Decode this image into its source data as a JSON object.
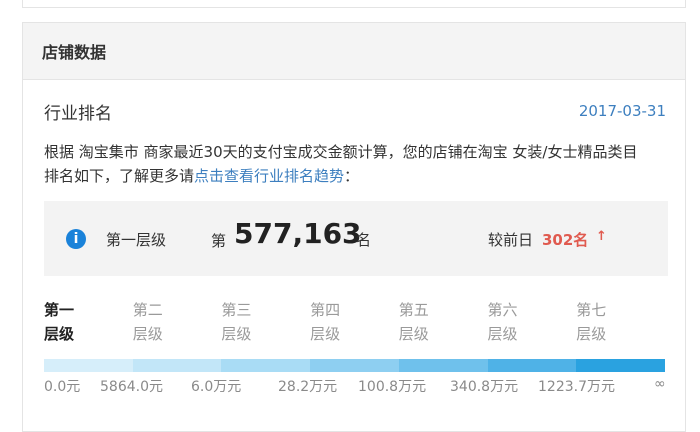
{
  "panel": {
    "title": "店铺数据"
  },
  "ranking": {
    "title": "行业排名",
    "date": "2017-03-31",
    "description_prefix": "根据 淘宝集市 商家最近30天的支付宝成交金额计算，您的店铺在淘宝 女装/女士精品类目排名如下，了解更多请",
    "description_link": "点击查看行业排名趋势",
    "description_suffix": "："
  },
  "summary": {
    "info_icon": "i",
    "level_name": "第一层级",
    "rank_prefix": "第",
    "rank_number": "577,163",
    "rank_suffix": "名",
    "compare_label": "较前日",
    "compare_value": "302名",
    "compare_arrow": "↑",
    "compare_color": "#e05a4f"
  },
  "levels": [
    {
      "line1": "第一",
      "line2": "层级",
      "active": true
    },
    {
      "line1": "第二",
      "line2": "层级",
      "active": false
    },
    {
      "line1": "第三",
      "line2": "层级",
      "active": false
    },
    {
      "line1": "第四",
      "line2": "层级",
      "active": false
    },
    {
      "line1": "第五",
      "line2": "层级",
      "active": false
    },
    {
      "line1": "第六",
      "line2": "层级",
      "active": false
    },
    {
      "line1": "第七",
      "line2": "层级",
      "active": false
    }
  ],
  "bar_colors": [
    "#d6eefa",
    "#c2e6f8",
    "#a9dcf5",
    "#8ecff1",
    "#6fc1ec",
    "#4fb2e7",
    "#2aa2e0"
  ],
  "thresholds": [
    "0.0元",
    "5864.0元",
    "6.0万元",
    "28.2万元",
    "100.8万元",
    "340.8万元",
    "1223.7万元",
    "∞"
  ],
  "accent_color": "#3d7fbf"
}
